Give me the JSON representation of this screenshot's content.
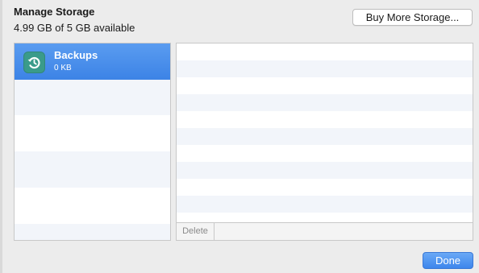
{
  "dialog": {
    "title": "Manage Storage",
    "subtitle": "4.99 GB of 5 GB available",
    "buy_button_label": "Buy More Storage...",
    "done_button_label": "Done"
  },
  "storage_list": {
    "items": [
      {
        "name": "Backups",
        "size": "0 KB",
        "icon": "backup-restore-icon",
        "selected": true
      }
    ]
  },
  "details": {
    "delete_button_label": "Delete"
  },
  "colors": {
    "selection": "#3c83e6",
    "stripe": "#f2f5fa",
    "icon_bg": "#3a9b8a",
    "done_button": "#3d86ec"
  }
}
